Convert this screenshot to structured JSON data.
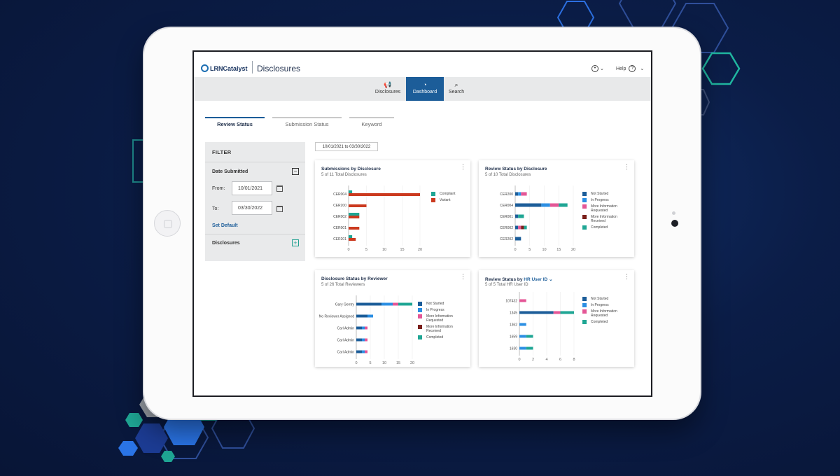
{
  "colors": {
    "background": "#0b1d47",
    "accent": "#1c5d99",
    "not_started": "#1c5d99",
    "in_progress": "#2c8fe3",
    "more_info_requested": "#e45696",
    "more_info_received": "#7a1f1a",
    "completed": "#1fa694",
    "compliant": "#1fa694",
    "variant": "#cb3a1f"
  },
  "app": {
    "logo_text": "LRNCatalyst",
    "title": "Disclosures",
    "help_label": "Help"
  },
  "nav": [
    {
      "label": "Disclosures",
      "icon": "megaphone-icon",
      "glyph": "📢"
    },
    {
      "label": "Dashboard",
      "icon": "gauge-icon",
      "glyph": "◔"
    },
    {
      "label": "Search",
      "icon": "search-icon",
      "glyph": "⌕"
    }
  ],
  "tabs": [
    {
      "label": "Review Status"
    },
    {
      "label": "Submission Status"
    },
    {
      "label": "Keyword"
    }
  ],
  "filter": {
    "title": "FILTER",
    "date_label": "Date Submitted",
    "from_label": "From:",
    "from_value": "10/01/2021",
    "to_label": "To:",
    "to_value": "03/30/2022",
    "set_default": "Set Default",
    "disclosures_label": "Disclosures"
  },
  "date_range": "10/01/2021 to 03/30/2022",
  "cards": [
    {
      "title": "Submissions by Disclosure",
      "subtitle": "5 of 11 Total Disclosures"
    },
    {
      "title": "Review Status by Disclosure",
      "subtitle": "5 of 10 Total Disclosures"
    },
    {
      "title": "Disclosure Status by Reviewer",
      "subtitle": "5 of 26 Total Reviewers"
    },
    {
      "title_prefix": "Review Status by",
      "title_link": "HR User ID",
      "subtitle": "5 of 5 Total HR User ID"
    }
  ],
  "legends": {
    "compliance": [
      "Compliant",
      "Variant"
    ],
    "status": [
      "Not Started",
      "In Progress",
      "More Information Requested",
      "More Information Received",
      "Completed"
    ],
    "status_short": [
      "Not Started",
      "In Progress",
      "More Information Requested",
      "Completed"
    ]
  },
  "chart_data": [
    {
      "type": "bar",
      "title": "Submissions by Disclosure",
      "orientation": "horizontal",
      "categories": [
        "CER004",
        "CER200",
        "CER002",
        "CER001",
        "CER201"
      ],
      "series": [
        {
          "name": "Compliant",
          "values": [
            1,
            0,
            3,
            0,
            1
          ]
        },
        {
          "name": "Variant",
          "values": [
            20,
            5,
            3,
            3,
            2
          ]
        }
      ],
      "xlim": [
        0,
        20
      ],
      "xticks": [
        0,
        5,
        10,
        15,
        20
      ]
    },
    {
      "type": "bar",
      "title": "Review Status by Disclosure",
      "orientation": "horizontal",
      "stacked": true,
      "categories": [
        "CER200",
        "CER004",
        "CER001",
        "CER002",
        "CER202"
      ],
      "series": [
        {
          "name": "Not Started",
          "values": [
            1,
            9,
            1,
            1,
            2
          ]
        },
        {
          "name": "In Progress",
          "values": [
            1,
            3,
            0,
            0,
            0
          ]
        },
        {
          "name": "More Information Requested",
          "values": [
            2,
            3,
            0,
            1,
            0
          ]
        },
        {
          "name": "More Information Received",
          "values": [
            0,
            0,
            0,
            1,
            0
          ]
        },
        {
          "name": "Completed",
          "values": [
            0,
            3,
            2,
            1,
            0
          ]
        }
      ],
      "xlim": [
        0,
        20
      ],
      "xticks": [
        0,
        5,
        10,
        15,
        20
      ]
    },
    {
      "type": "bar",
      "title": "Disclosure Status by Reviewer",
      "orientation": "horizontal",
      "stacked": true,
      "categories": [
        "Gary Gentry",
        "No Reviewer Assigned",
        "Carl Admin",
        "Carl Admin",
        "Carl Admin"
      ],
      "series": [
        {
          "name": "Not Started",
          "values": [
            9,
            4,
            2,
            2,
            2
          ]
        },
        {
          "name": "In Progress",
          "values": [
            4,
            2,
            1,
            1,
            1
          ]
        },
        {
          "name": "More Information Requested",
          "values": [
            2,
            0,
            1,
            1,
            1
          ]
        },
        {
          "name": "More Information Received",
          "values": [
            0,
            0,
            0,
            0,
            0
          ]
        },
        {
          "name": "Completed",
          "values": [
            5,
            0,
            0,
            0,
            0
          ]
        }
      ],
      "xlim": [
        0,
        20
      ],
      "xticks": [
        0,
        5,
        10,
        15,
        20
      ]
    },
    {
      "type": "bar",
      "title": "Review Status by HR User ID",
      "orientation": "horizontal",
      "stacked": true,
      "categories": [
        "107432",
        "1345",
        "1362",
        "1659",
        "1630"
      ],
      "series": [
        {
          "name": "Not Started",
          "values": [
            0,
            5,
            0,
            0,
            0
          ]
        },
        {
          "name": "In Progress",
          "values": [
            0,
            0,
            1,
            1,
            1
          ]
        },
        {
          "name": "More Information Requested",
          "values": [
            1,
            1,
            0,
            0,
            0
          ]
        },
        {
          "name": "Completed",
          "values": [
            0,
            2,
            0,
            1,
            1
          ]
        }
      ],
      "xlim": [
        0,
        8
      ],
      "xticks": [
        0,
        2,
        4,
        6,
        8
      ]
    }
  ]
}
